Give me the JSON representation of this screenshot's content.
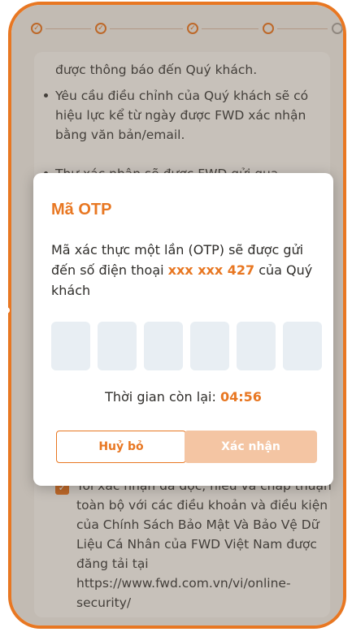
{
  "stepper": {
    "steps": [
      {
        "state": "done"
      },
      {
        "state": "done"
      },
      {
        "state": "done"
      },
      {
        "state": "current"
      },
      {
        "state": "upcoming"
      }
    ],
    "check_glyph": "✓"
  },
  "background_text": {
    "line_partial": "được thông báo đến Quý khách.",
    "bullet_1": "Yêu cầu điều chỉnh của Quý khách sẽ có hiệu lực kể từ ngày được FWD xác nhận bằng văn bản/email.",
    "bullet_2_partial": "Thư xác nhận sẽ được FWD gửi qua",
    "consent_text": "Tôi xác nhận đã đọc, hiểu và chấp thuận toàn bộ với các điều khoản và điều kiện của Chính Sách Bảo Mật Và Bảo Vệ Dữ Liệu Cá Nhân của FWD Việt Nam được đăng tải tại https://www.fwd.com.vn/vi/online-security/",
    "consent_checked": true
  },
  "otp_modal": {
    "title": "Mã OTP",
    "message_before": "Mã xác thực một lần (OTP) sẽ được gửi đến số điện thoại",
    "phone_masked": "xxx xxx 427",
    "message_after": "của Quý khách",
    "digits": [
      "",
      "",
      "",
      "",
      "",
      ""
    ],
    "timer_label": "Thời gian còn lại:",
    "timer_value": "04:56",
    "cancel_label": "Huỷ bỏ",
    "confirm_label": "Xác nhận"
  },
  "colors": {
    "brand_orange": "#e87722",
    "confirm_disabled": "#f4c5a3",
    "otp_box_bg": "#e8eef3"
  }
}
